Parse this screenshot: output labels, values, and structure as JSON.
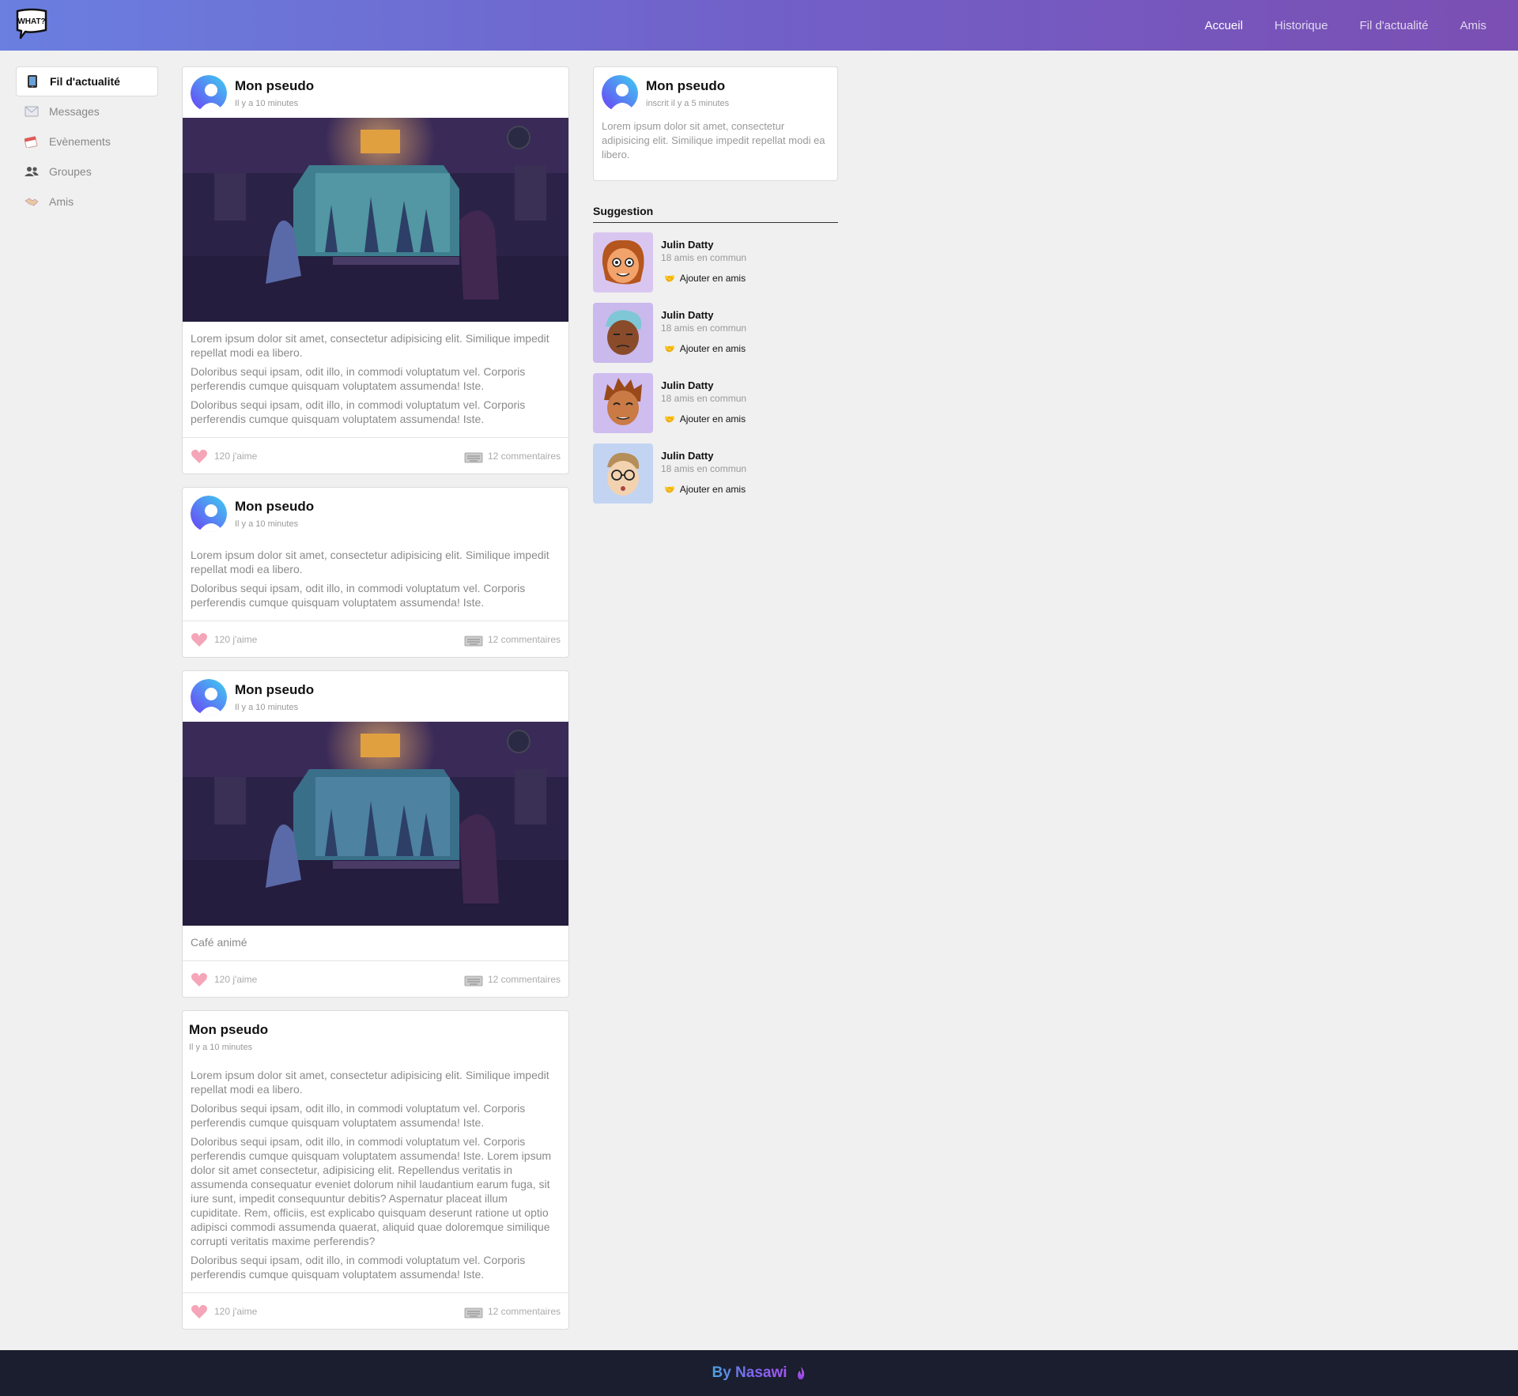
{
  "header": {
    "logo_text": "WHAT?",
    "nav": [
      {
        "label": "Accueil",
        "active": true
      },
      {
        "label": "Historique",
        "active": false
      },
      {
        "label": "Fil d'actualité",
        "active": false
      },
      {
        "label": "Amis",
        "active": false
      }
    ]
  },
  "sidebar": {
    "items": [
      {
        "label": "Fil d'actualité",
        "icon": "phone-icon",
        "active": true
      },
      {
        "label": "Messages",
        "icon": "envelope-icon",
        "active": false
      },
      {
        "label": "Evènements",
        "icon": "calendar-icon",
        "active": false
      },
      {
        "label": "Groupes",
        "icon": "group-icon",
        "active": false
      },
      {
        "label": "Amis",
        "icon": "handshake-icon",
        "active": false
      }
    ]
  },
  "posts": [
    {
      "name": "Mon pseudo",
      "time": "Il y a 10 minutes",
      "has_image": true,
      "paragraphs": [
        "Lorem ipsum dolor sit amet, consectetur adipisicing elit. Similique impedit repellat modi ea libero.",
        "Doloribus sequi ipsam, odit illo, in commodi voluptatum vel. Corporis perferendis cumque quisquam voluptatem assumenda! Iste.",
        "Doloribus sequi ipsam, odit illo, in commodi voluptatum vel. Corporis perferendis cumque quisquam voluptatem assumenda! Iste."
      ],
      "likes": "120 j'aime",
      "comments": "12 commentaires"
    },
    {
      "name": "Mon pseudo",
      "time": "Il y a 10 minutes",
      "has_image": false,
      "paragraphs": [
        "Lorem ipsum dolor sit amet, consectetur adipisicing elit. Similique impedit repellat modi ea libero.",
        "Doloribus sequi ipsam, odit illo, in commodi voluptatum vel. Corporis perferendis cumque quisquam voluptatem assumenda! Iste."
      ],
      "likes": "120 j'aime",
      "comments": "12 commentaires"
    },
    {
      "name": "Mon pseudo",
      "time": "Il y a 10 minutes",
      "has_image": true,
      "paragraphs": [
        "Café animé"
      ],
      "likes": "120 j'aime",
      "comments": "12 commentaires"
    },
    {
      "name": "Mon pseudo",
      "time": "Il y a 10 minutes",
      "has_image": false,
      "no_avatar": true,
      "paragraphs": [
        "Lorem ipsum dolor sit amet, consectetur adipisicing elit. Similique impedit repellat modi ea libero.",
        "Doloribus sequi ipsam, odit illo, in commodi voluptatum vel. Corporis perferendis cumque quisquam voluptatem assumenda! Iste.",
        "Doloribus sequi ipsam, odit illo, in commodi voluptatum vel. Corporis perferendis cumque quisquam voluptatem assumenda! Iste. Lorem ipsum dolor sit amet consectetur, adipisicing elit. Repellendus veritatis in assumenda consequatur eveniet dolorum nihil laudantium earum fuga, sit iure sunt, impedit consequuntur debitis? Aspernatur placeat illum cupiditate. Rem, officiis, est explicabo quisquam deserunt ratione ut optio adipisci commodi assumenda quaerat, aliquid quae doloremque similique corrupti veritatis maxime perferendis?",
        "Doloribus sequi ipsam, odit illo, in commodi voluptatum vel. Corporis perferendis cumque quisquam voluptatem assumenda! Iste."
      ],
      "likes": "120 j'aime",
      "comments": "12 commentaires"
    }
  ],
  "profile": {
    "name": "Mon pseudo",
    "subtitle": "inscrit il y a 5 minutes",
    "description": "Lorem ipsum dolor sit amet, consectetur adipisicing elit. Similique impedit repellat modi ea libero."
  },
  "suggestion": {
    "title": "Suggestion",
    "items": [
      {
        "name": "Julin Datty",
        "common": "18 amis en commun",
        "add_label": "Ajouter en amis",
        "bg": "#d9c6f0",
        "skin": "#f2a36b",
        "hair": "#b5561e"
      },
      {
        "name": "Julin Datty",
        "common": "18 amis en commun",
        "add_label": "Ajouter en amis",
        "bg": "#c9b9ec",
        "skin": "#8a4b2b",
        "hair": "#7fc7d6"
      },
      {
        "name": "Julin Datty",
        "common": "18 amis en commun",
        "add_label": "Ajouter en amis",
        "bg": "#cfbdf0",
        "skin": "#c97a45",
        "hair": "#9a4a1a"
      },
      {
        "name": "Julin Datty",
        "common": "18 amis en commun",
        "add_label": "Ajouter en amis",
        "bg": "#c3d4f2",
        "skin": "#f3d2b0",
        "hair": "#b58e5a"
      }
    ]
  },
  "footer": {
    "text": "By Nasawi"
  }
}
